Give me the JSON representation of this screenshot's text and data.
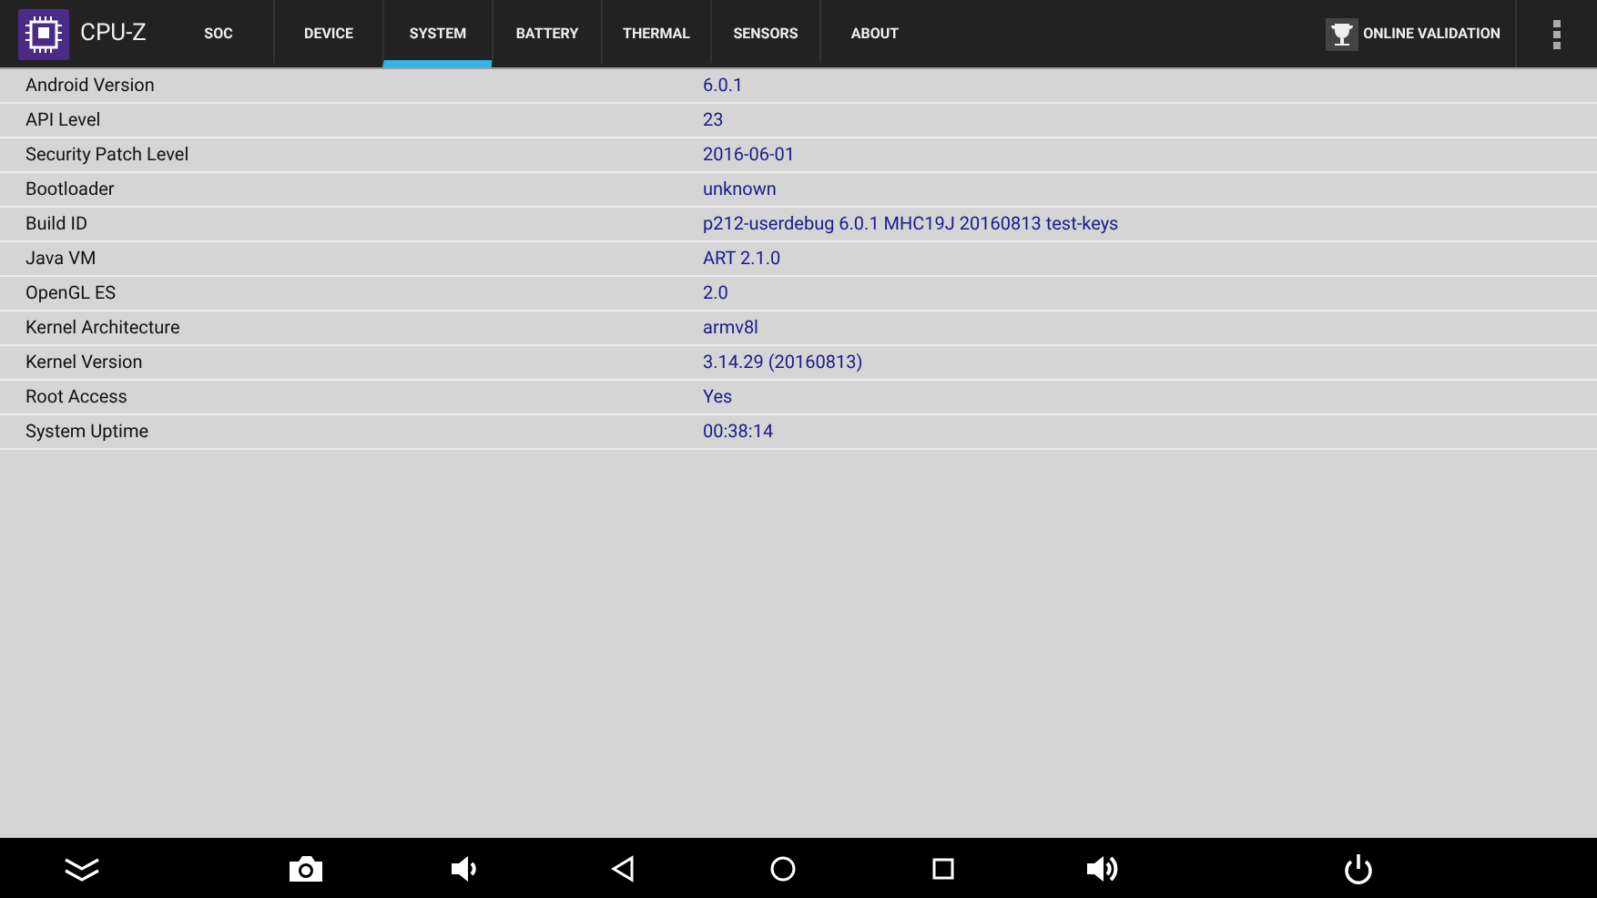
{
  "app": {
    "title": "CPU-Z"
  },
  "tabs": [
    {
      "label": "SOC",
      "selected": false
    },
    {
      "label": "DEVICE",
      "selected": false
    },
    {
      "label": "SYSTEM",
      "selected": true
    },
    {
      "label": "BATTERY",
      "selected": false
    },
    {
      "label": "THERMAL",
      "selected": false
    },
    {
      "label": "SENSORS",
      "selected": false
    },
    {
      "label": "ABOUT",
      "selected": false
    }
  ],
  "validation_button": {
    "label": "ONLINE VALIDATION"
  },
  "rows": [
    {
      "label": "Android Version",
      "value": "6.0.1"
    },
    {
      "label": "API Level",
      "value": "23"
    },
    {
      "label": "Security Patch Level",
      "value": "2016-06-01"
    },
    {
      "label": "Bootloader",
      "value": "unknown"
    },
    {
      "label": "Build ID",
      "value": "p212-userdebug 6.0.1 MHC19J 20160813 test-keys"
    },
    {
      "label": "Java VM",
      "value": "ART 2.1.0"
    },
    {
      "label": "OpenGL ES",
      "value": "2.0"
    },
    {
      "label": "Kernel Architecture",
      "value": "armv8l"
    },
    {
      "label": "Kernel Version",
      "value": "3.14.29 (20160813)"
    },
    {
      "label": "Root Access",
      "value": "Yes"
    },
    {
      "label": "System Uptime",
      "value": "00:38:14"
    }
  ]
}
